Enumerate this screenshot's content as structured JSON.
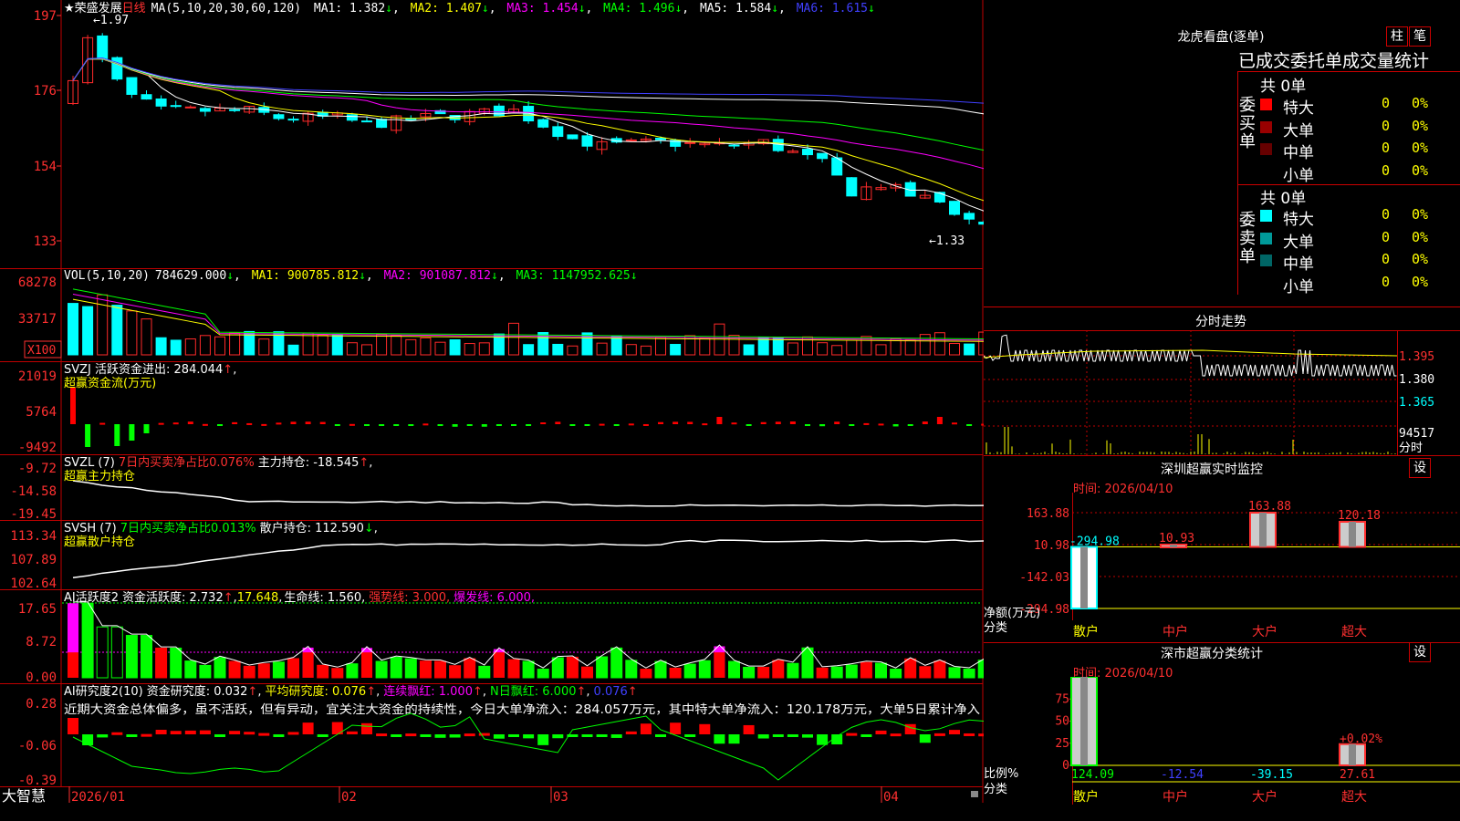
{
  "colors": {
    "up": "#ff2a2a",
    "down": "#00ffff",
    "axis": "#ff3030",
    "panelBorder": "#c00000",
    "text": "#ffffff",
    "yellow": "#ffff00",
    "magenta": "#ff00ff",
    "green": "#00ff00",
    "blue": "#4040ff",
    "labelRed": "#ff3030"
  },
  "main": {
    "title": "★荣盛发展",
    "period": "日线",
    "ma_header": "MA(5,10,20,30,60,120)",
    "ma": [
      {
        "label": "MA1: 1.382",
        "arrow": "↓",
        "color": "#ffffff"
      },
      {
        "label": "MA2: 1.407",
        "arrow": "↓",
        "color": "#ffff00"
      },
      {
        "label": "MA3: 1.454",
        "arrow": "↓",
        "color": "#ff00ff"
      },
      {
        "label": "MA4: 1.496",
        "arrow": "↓",
        "color": "#00ff00"
      },
      {
        "label": "MA5: 1.584",
        "arrow": "↓",
        "color": "#ffffff"
      },
      {
        "label": "MA6: 1.615",
        "arrow": "↓",
        "color": "#4040ff"
      }
    ],
    "yticks": [
      "197",
      "176",
      "154",
      "133"
    ],
    "high_mark": "←1.97",
    "low_mark": "←1.33"
  },
  "vol": {
    "title": "VOL(5,10,20)",
    "value": "784629.000",
    "arrow": "↓",
    "ma": [
      {
        "label": "MA1: 900785.812",
        "arrow": "↓",
        "color": "#ffff00"
      },
      {
        "label": "MA2: 901087.812",
        "arrow": "↓",
        "color": "#ff00ff"
      },
      {
        "label": "MA3: 1147952.625",
        "arrow": "↓",
        "color": "#00ff00"
      }
    ],
    "yticks": [
      "68278",
      "33717"
    ],
    "unit": "X100"
  },
  "svzj": {
    "title": "SVZJ  活跃资金进出: 284.044",
    "arrow": "↑",
    "comma": ",",
    "subtitle": "超赢资金流(万元)",
    "yticks": [
      "21019",
      "5764",
      "-9492"
    ]
  },
  "svzl": {
    "title": "SVZL (7)",
    "pct": "7日内买卖净占比0.076%",
    "main": "主力持仓: -18.545",
    "arrow": "↑",
    "comma": ",",
    "subtitle": "超赢主力持仓",
    "yticks": [
      "-9.72",
      "-14.58",
      "-19.45"
    ]
  },
  "svsh": {
    "title": "SVSH (7)",
    "pct": "7日内买卖净占比0.013%",
    "main": "散户持仓: 112.590",
    "arrow": "↓",
    "comma": ",",
    "subtitle": "超赢散户持仓",
    "yticks": [
      "113.34",
      "107.89",
      "102.64"
    ]
  },
  "ai1": {
    "title": "AI活跃度2",
    "a": "资金活跃度: 2.732",
    "a_arrow": "↑",
    "b": "17.648",
    "c": "生命线: 1.560",
    "d": "强势线: 3.000",
    "e": "爆发线: 6.000",
    "end": ",",
    "yticks": [
      "17.65",
      "8.72",
      "0.00"
    ]
  },
  "ai2": {
    "title": "AI研究度2(10)",
    "a": "资金研究度: 0.032",
    "a_arrow": "↑",
    "b": "平均研究度: 0.076",
    "b_arrow": "↑",
    "c": "连续飘红: 1.000",
    "c_arrow": "↑",
    "d": "N日飘红: 6.000",
    "d_arrow": "↑",
    "e": "0.076",
    "e_arrow": "↑",
    "comment": "近期大资金总体偏多，虽不活跃，但有异动，宜关注大资金的持续性，今日大单净流入：284.057万元，其中特大单净流入：120.178万元，大单5日累计净入",
    "yticks": [
      "0.28",
      "-0.06",
      "-0.39"
    ]
  },
  "xaxis": {
    "brand": "大智慧",
    "labels": [
      "2026/01",
      "02",
      "03",
      "04"
    ]
  },
  "lhb": {
    "title": "龙虎看盘(逐单)",
    "btn1": "柱",
    "btn2": "笔",
    "tabs": "已成交委托单成交量统计",
    "buy": {
      "side": "委买单",
      "count": "共 0单",
      "rows": [
        {
          "name": "特大",
          "v": "0",
          "p": "0%",
          "color": "#ff0000"
        },
        {
          "name": "大单",
          "v": "0",
          "p": "0%",
          "color": "#990000"
        },
        {
          "name": "中单",
          "v": "0",
          "p": "0%",
          "color": "#660000"
        },
        {
          "name": "小单",
          "v": "0",
          "p": "0%",
          "color": ""
        }
      ]
    },
    "sell": {
      "side": "委卖单",
      "count": "共 0单",
      "rows": [
        {
          "name": "特大",
          "v": "0",
          "p": "0%",
          "color": "#00ffff"
        },
        {
          "name": "大单",
          "v": "0",
          "p": "0%",
          "color": "#009999"
        },
        {
          "name": "中单",
          "v": "0",
          "p": "0%",
          "color": "#006666"
        },
        {
          "name": "小单",
          "v": "0",
          "p": "0%",
          "color": ""
        }
      ]
    }
  },
  "fenshi": {
    "title": "分时走势",
    "yticks": [
      "1.395",
      "1.380",
      "1.365"
    ],
    "vol": "94517",
    "label": "分时"
  },
  "sz_monitor": {
    "title": "深圳超赢实时监控",
    "btn": "设",
    "time": "时间: 2026/04/10",
    "yticks": [
      "163.88",
      "10.98",
      "-142.03",
      "-294.98"
    ],
    "ylabel": "净额(万元)",
    "xlabel": "分类",
    "cats": [
      "散户",
      "中户",
      "大户",
      "超大"
    ],
    "values": [
      "-294.98",
      "10.93",
      "163.88",
      "120.18"
    ]
  },
  "sz_class": {
    "title": "深市超赢分类统计",
    "btn": "设",
    "time": "时间: 2026/04/10",
    "yticks": [
      "75",
      "50",
      "25",
      "0"
    ],
    "ylabel": "比例%",
    "xlabel": "分类",
    "cats": [
      "散户",
      "中户",
      "大户",
      "超大"
    ],
    "values": [
      "124.09",
      "-12.54",
      "-39.15",
      "27.61"
    ],
    "bar_label": "+0.02%"
  }
}
